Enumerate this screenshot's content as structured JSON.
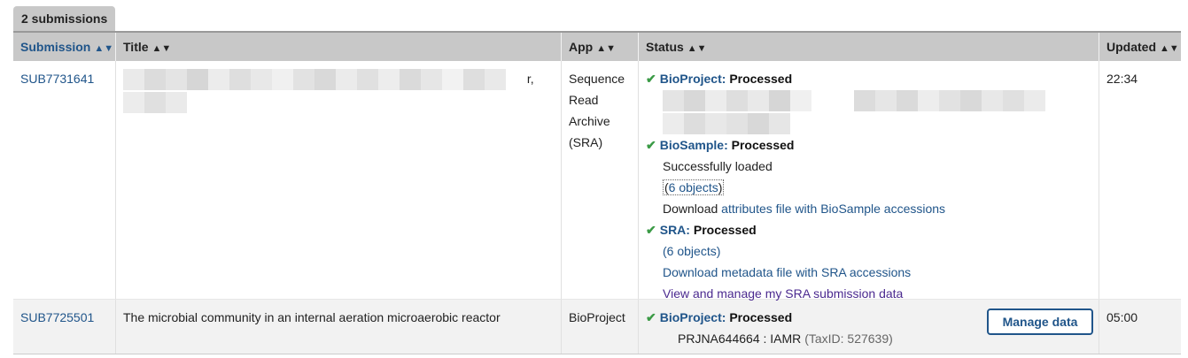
{
  "tab": {
    "label": "2 submissions"
  },
  "columns": [
    {
      "label": "Submission",
      "active": true
    },
    {
      "label": "Title"
    },
    {
      "label": "App"
    },
    {
      "label": "Status"
    },
    {
      "label": "Updated"
    }
  ],
  "rows": [
    {
      "id": "SUB7731641",
      "title_fragment": "r,",
      "app": [
        "Sequence",
        "Read",
        "Archive",
        "(SRA)"
      ],
      "bioproject": {
        "label": "BioProject:",
        "status": "Processed"
      },
      "biosample": {
        "label": "BioSample:",
        "status": "Processed",
        "loaded": "Successfully loaded",
        "objects_open": "(",
        "objects_link": "6 objects",
        "objects_close": ")",
        "download_prefix": "Download",
        "download_link": "attributes file with BioSample accessions"
      },
      "sra": {
        "label": "SRA:",
        "status": "Processed",
        "objects_open": "(",
        "objects_link": "6 objects",
        "objects_close": ")",
        "download_link": "Download metadata file with SRA accessions",
        "manage_link": "View and manage my SRA submission data"
      },
      "updated": "22:34"
    },
    {
      "id": "SUB7725501",
      "title": "The microbial community in an internal aeration microaerobic reactor",
      "app": "BioProject",
      "bioproject": {
        "label": "BioProject:",
        "status": "Processed",
        "accession": "PRJNA644664 : IAMR",
        "taxid": "(TaxID: 527639)"
      },
      "manage_button": "Manage data",
      "updated": "05:00"
    }
  ]
}
